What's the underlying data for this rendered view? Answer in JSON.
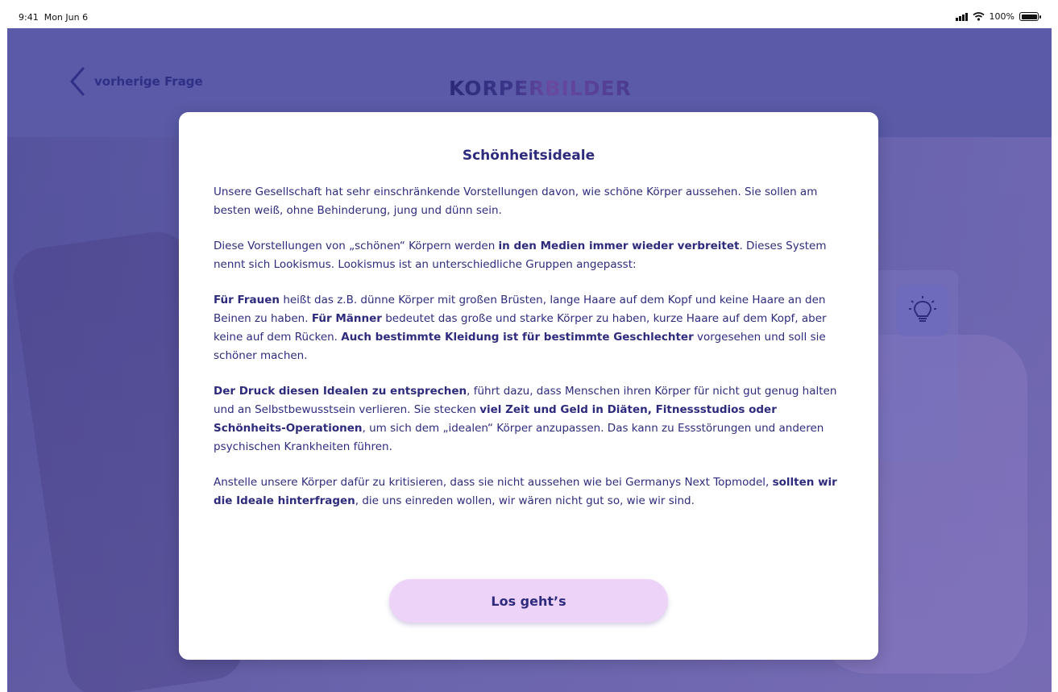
{
  "status_bar": {
    "time": "9:41",
    "date": "Mon Jun 6",
    "battery": "100%"
  },
  "header": {
    "back_label": "vorherige Frage",
    "logo_text": "KORPERBILDER"
  },
  "icons": {
    "back": "chevron-left-icon",
    "hint": "lightbulb-icon",
    "signal": "signal-icon",
    "wifi": "wifi-icon",
    "battery": "battery-icon"
  },
  "colors": {
    "accent": "#2e2b7d",
    "background": "#5a5aa8",
    "button": "#eed3f8"
  },
  "dialog": {
    "title": "Schönheitsideale",
    "paragraphs": [
      [
        {
          "t": "Unsere Gesellschaft hat sehr einschränkende Vorstellungen davon, wie schöne Körper aussehen. Sie sollen am besten weiß, ohne Behinderung, jung und dünn sein."
        }
      ],
      [
        {
          "t": "Diese Vorstellungen von „schönen“ Körpern werden "
        },
        {
          "t": "in den Medien immer wieder verbreitet",
          "b": true
        },
        {
          "t": ". Dieses System nennt sich Lookismus. Lookismus ist an unterschiedliche Gruppen angepasst:"
        }
      ],
      [
        {
          "t": "Für Frauen",
          "b": true
        },
        {
          "t": " heißt das z.B. dünne Körper mit großen Brüsten, lange Haare auf dem Kopf und keine Haare an den Beinen zu haben. "
        },
        {
          "t": "Für Männer",
          "b": true
        },
        {
          "t": " bedeutet das große und starke Körper zu haben, kurze Haare auf dem Kopf, aber keine auf dem Rücken. "
        },
        {
          "t": "Auch bestimmte Kleidung ist für bestimmte Geschlechter",
          "b": true
        },
        {
          "t": " vorgesehen und soll sie schöner machen."
        }
      ],
      [
        {
          "t": "Der Druck diesen Idealen zu entsprechen",
          "b": true
        },
        {
          "t": ", führt dazu, dass Menschen ihren Körper für nicht gut genug halten und an Selbstbewusstsein verlieren. Sie stecken "
        },
        {
          "t": "viel Zeit und Geld in Diäten, Fitnessstudios oder Schönheits-Operationen",
          "b": true
        },
        {
          "t": ", um sich dem „idealen“ Körper anzupassen. Das kann zu Essstörungen und anderen psychischen Krankheiten führen."
        }
      ],
      [
        {
          "t": "Anstelle unsere Körper dafür zu kritisieren, dass sie nicht aussehen wie bei Germanys Next Topmodel, "
        },
        {
          "t": "sollten wir die Ideale hinterfragen",
          "b": true
        },
        {
          "t": ", die uns einreden wollen, wir wären nicht gut so, wie wir sind."
        }
      ]
    ],
    "button_label": "Los geht’s"
  }
}
